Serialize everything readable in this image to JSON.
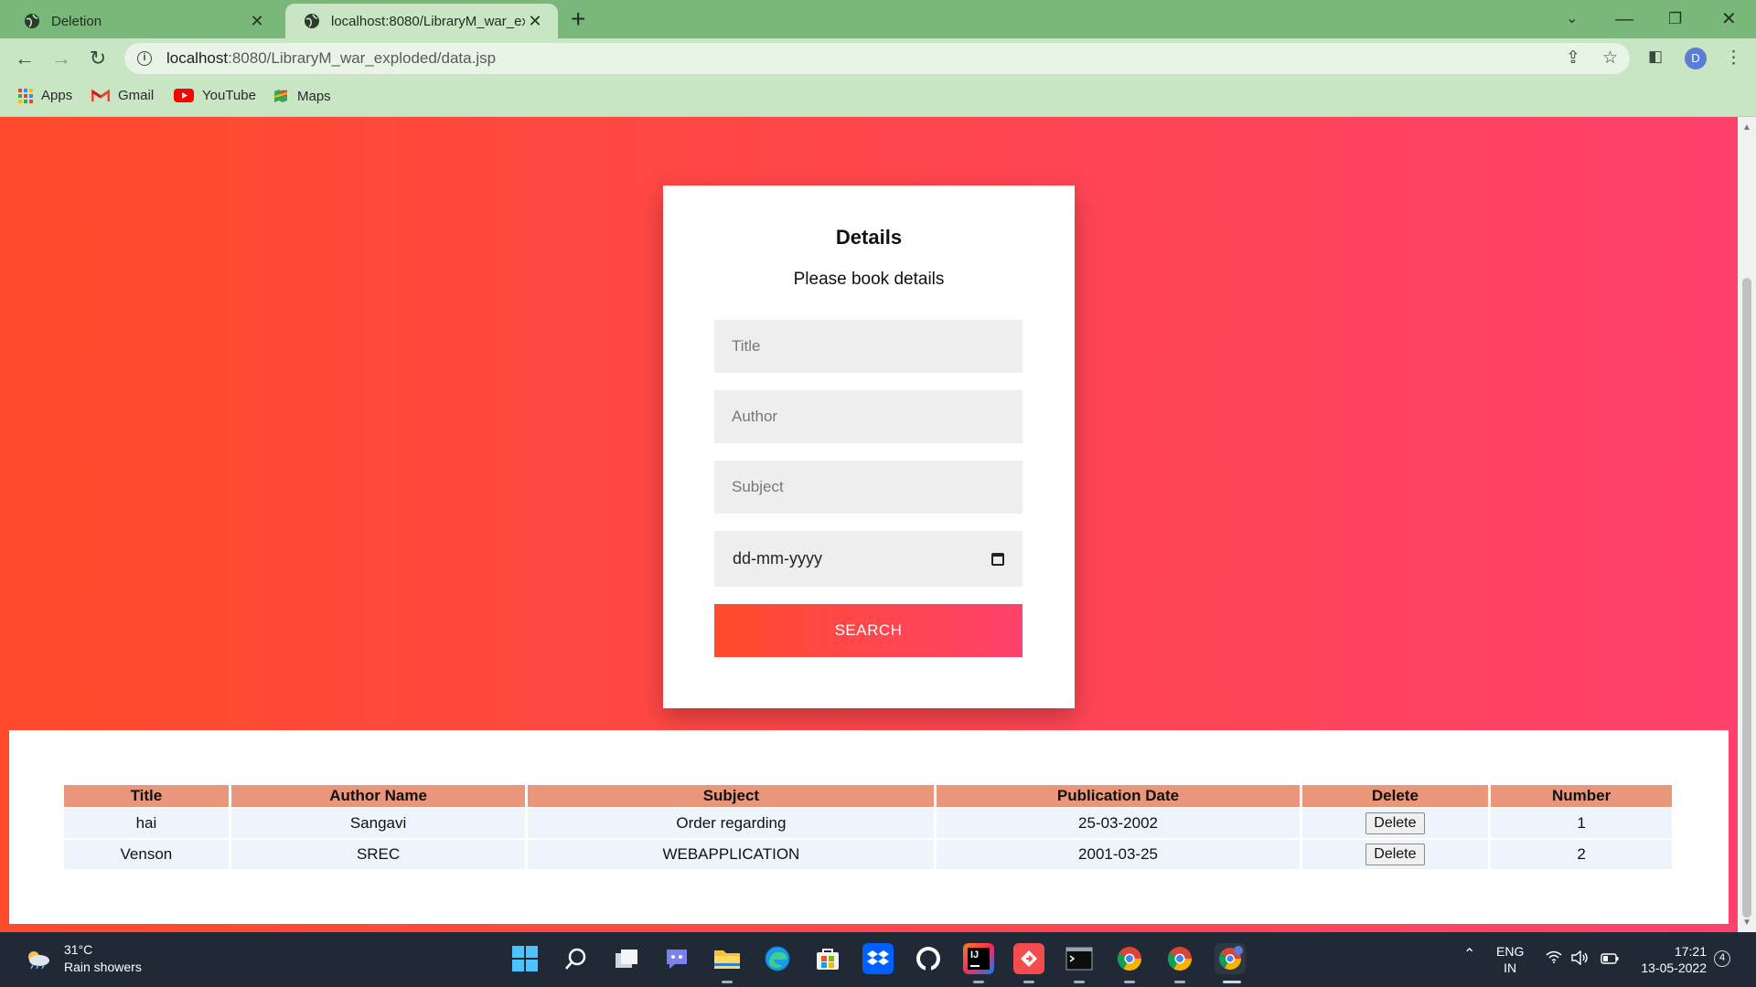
{
  "browser": {
    "tabs": [
      {
        "title": "Deletion",
        "active": false
      },
      {
        "title": "localhost:8080/LibraryM_war_exp",
        "active": true
      }
    ],
    "url_host": "localhost",
    "url_path": ":8080/LibraryM_war_exploded/data.jsp",
    "profile_initial": "D",
    "bookmarks": [
      {
        "label": "Apps",
        "icon": "apps-grid-icon"
      },
      {
        "label": "Gmail",
        "icon": "gmail-icon"
      },
      {
        "label": "YouTube",
        "icon": "youtube-icon"
      },
      {
        "label": "Maps",
        "icon": "maps-icon"
      }
    ]
  },
  "form": {
    "heading": "Details",
    "subheading": "Please book details",
    "title_placeholder": "Title",
    "author_placeholder": "Author",
    "subject_placeholder": "Subject",
    "date_placeholder": "dd-mm-yyyy",
    "search_label": "SEARCH"
  },
  "table": {
    "headers": [
      "Title",
      "Author Name",
      "Subject",
      "Publication Date",
      "Delete",
      "Number"
    ],
    "rows": [
      {
        "title": "hai",
        "author": "Sangavi",
        "subject": "Order regarding",
        "date": "25-03-2002",
        "delete_label": "Delete",
        "number": "1"
      },
      {
        "title": "Venson",
        "author": "SREC",
        "subject": "WEBAPPLICATION",
        "date": "2001-03-25",
        "delete_label": "Delete",
        "number": "2"
      }
    ]
  },
  "taskbar": {
    "temperature": "31°C",
    "weather": "Rain showers",
    "lang_top": "ENG",
    "lang_bottom": "IN",
    "time": "17:21",
    "date": "13-05-2022",
    "notification_count": "4"
  },
  "colors": {
    "gradient_start": "#ff4b2b",
    "gradient_end": "#ff416c",
    "table_header": "#e9967a",
    "chrome_green": "#79b77a"
  }
}
